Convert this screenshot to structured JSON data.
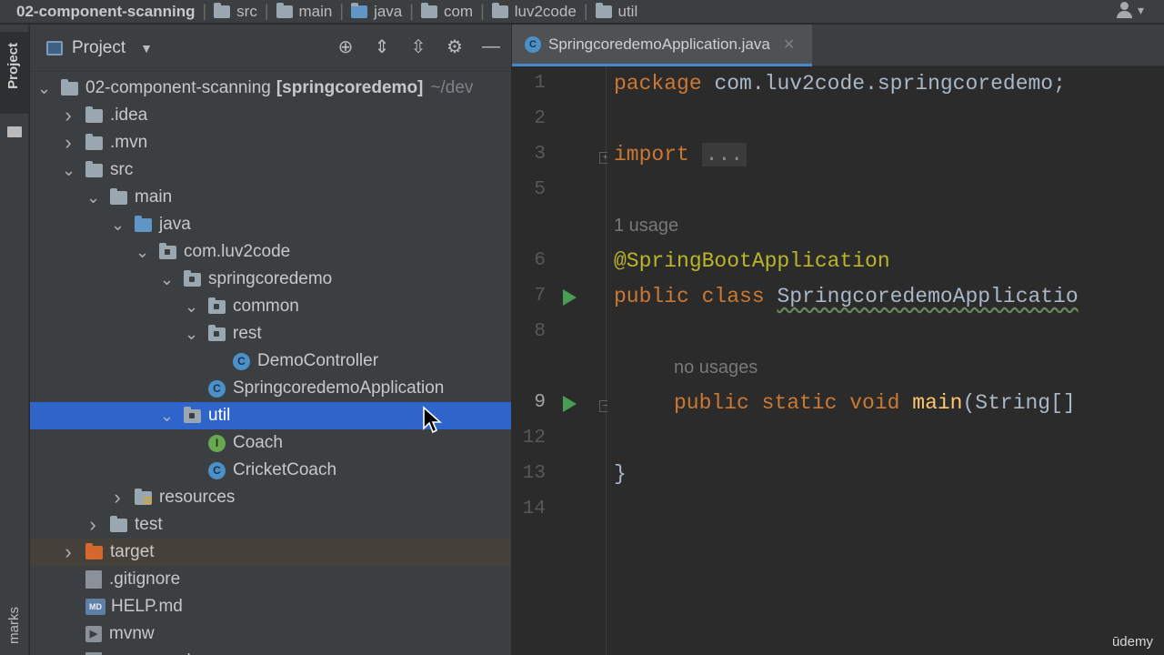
{
  "breadcrumb": {
    "items": [
      "02-component-scanning",
      "src",
      "main",
      "java",
      "com",
      "luv2code",
      "util"
    ]
  },
  "left_strip": {
    "project_tab": "Project",
    "bottom_tab": "marks"
  },
  "project_panel": {
    "title": "Project",
    "tree": [
      {
        "label": "02-component-scanning",
        "bold": "[springcoredemo]",
        "path": "~/dev",
        "type": "module",
        "expanded": true,
        "depth": 0
      },
      {
        "label": ".idea",
        "type": "folder",
        "expanded": false,
        "depth": 1
      },
      {
        "label": ".mvn",
        "type": "folder",
        "expanded": false,
        "depth": 1
      },
      {
        "label": "src",
        "type": "folder",
        "expanded": true,
        "depth": 1
      },
      {
        "label": "main",
        "type": "folder",
        "expanded": true,
        "depth": 2
      },
      {
        "label": "java",
        "type": "source-folder",
        "expanded": true,
        "depth": 3
      },
      {
        "label": "com.luv2code",
        "type": "package",
        "expanded": true,
        "depth": 4
      },
      {
        "label": "springcoredemo",
        "type": "package",
        "expanded": true,
        "depth": 5
      },
      {
        "label": "common",
        "type": "package",
        "expanded": true,
        "depth": 6
      },
      {
        "label": "rest",
        "type": "package",
        "expanded": true,
        "depth": 6
      },
      {
        "label": "DemoController",
        "type": "class",
        "depth": 7
      },
      {
        "label": "SpringcoredemoApplication",
        "type": "class",
        "depth": 6
      },
      {
        "label": "util",
        "type": "package",
        "expanded": true,
        "depth": 5,
        "selected": true
      },
      {
        "label": "Coach",
        "type": "interface",
        "depth": 6
      },
      {
        "label": "CricketCoach",
        "type": "class",
        "depth": 6
      },
      {
        "label": "resources",
        "type": "resources",
        "expanded": false,
        "depth": 3
      },
      {
        "label": "test",
        "type": "folder",
        "expanded": false,
        "depth": 2
      },
      {
        "label": "target",
        "type": "excluded",
        "expanded": false,
        "depth": 1
      },
      {
        "label": ".gitignore",
        "type": "file",
        "depth": 1
      },
      {
        "label": "HELP.md",
        "type": "md",
        "depth": 1
      },
      {
        "label": "mvnw",
        "type": "terminal",
        "depth": 1
      },
      {
        "label": "mvnw.cmd",
        "type": "file",
        "depth": 1
      }
    ]
  },
  "editor": {
    "tab_label": "SpringcoredemoApplication.java",
    "lines": [
      {
        "n": "1",
        "kind": "package",
        "kw": "package",
        "rest": "com.luv2code.springcoredemo;"
      },
      {
        "n": "2",
        "kind": "blank"
      },
      {
        "n": "3",
        "kind": "import",
        "kw": "import",
        "dots": "..."
      },
      {
        "n": "5",
        "kind": "blank"
      },
      {
        "kind": "hint",
        "text": "1 usage"
      },
      {
        "n": "6",
        "kind": "annotation",
        "text": "@SpringBootApplication"
      },
      {
        "n": "7",
        "kind": "class",
        "kw": "public class",
        "name": "SpringcoredemoApplicatio"
      },
      {
        "n": "8",
        "kind": "blank"
      },
      {
        "kind": "hint",
        "text": "no usages"
      },
      {
        "n": "9",
        "kind": "method",
        "kw": "public static void",
        "fn": "main",
        "rest": "(String[]"
      },
      {
        "n": "12",
        "kind": "blank"
      },
      {
        "n": "13",
        "kind": "close",
        "text": "}"
      },
      {
        "n": "14",
        "kind": "blank"
      }
    ]
  },
  "watermark": "ūdemy",
  "colors": {
    "selection": "#2f65ca",
    "keyword": "#cc7832",
    "annotation": "#bbb529",
    "method": "#ffc66d",
    "run_icon": "#499c54"
  }
}
